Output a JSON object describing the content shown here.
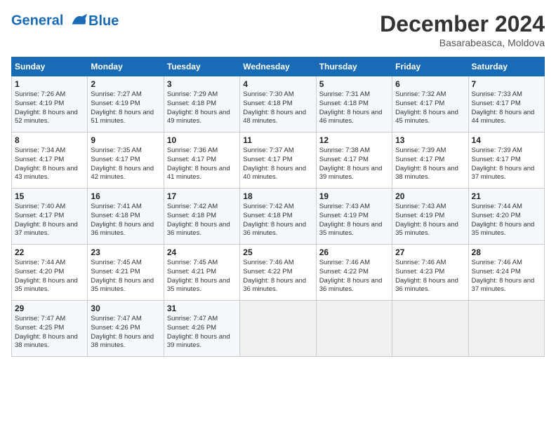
{
  "header": {
    "logo_line1": "General",
    "logo_line2": "Blue",
    "month_title": "December 2024",
    "subtitle": "Basarabeasca, Moldova"
  },
  "weekdays": [
    "Sunday",
    "Monday",
    "Tuesday",
    "Wednesday",
    "Thursday",
    "Friday",
    "Saturday"
  ],
  "weeks": [
    [
      {
        "day": "1",
        "sunrise": "Sunrise: 7:26 AM",
        "sunset": "Sunset: 4:19 PM",
        "daylight": "Daylight: 8 hours and 52 minutes."
      },
      {
        "day": "2",
        "sunrise": "Sunrise: 7:27 AM",
        "sunset": "Sunset: 4:19 PM",
        "daylight": "Daylight: 8 hours and 51 minutes."
      },
      {
        "day": "3",
        "sunrise": "Sunrise: 7:29 AM",
        "sunset": "Sunset: 4:18 PM",
        "daylight": "Daylight: 8 hours and 49 minutes."
      },
      {
        "day": "4",
        "sunrise": "Sunrise: 7:30 AM",
        "sunset": "Sunset: 4:18 PM",
        "daylight": "Daylight: 8 hours and 48 minutes."
      },
      {
        "day": "5",
        "sunrise": "Sunrise: 7:31 AM",
        "sunset": "Sunset: 4:18 PM",
        "daylight": "Daylight: 8 hours and 46 minutes."
      },
      {
        "day": "6",
        "sunrise": "Sunrise: 7:32 AM",
        "sunset": "Sunset: 4:17 PM",
        "daylight": "Daylight: 8 hours and 45 minutes."
      },
      {
        "day": "7",
        "sunrise": "Sunrise: 7:33 AM",
        "sunset": "Sunset: 4:17 PM",
        "daylight": "Daylight: 8 hours and 44 minutes."
      }
    ],
    [
      {
        "day": "8",
        "sunrise": "Sunrise: 7:34 AM",
        "sunset": "Sunset: 4:17 PM",
        "daylight": "Daylight: 8 hours and 43 minutes."
      },
      {
        "day": "9",
        "sunrise": "Sunrise: 7:35 AM",
        "sunset": "Sunset: 4:17 PM",
        "daylight": "Daylight: 8 hours and 42 minutes."
      },
      {
        "day": "10",
        "sunrise": "Sunrise: 7:36 AM",
        "sunset": "Sunset: 4:17 PM",
        "daylight": "Daylight: 8 hours and 41 minutes."
      },
      {
        "day": "11",
        "sunrise": "Sunrise: 7:37 AM",
        "sunset": "Sunset: 4:17 PM",
        "daylight": "Daylight: 8 hours and 40 minutes."
      },
      {
        "day": "12",
        "sunrise": "Sunrise: 7:38 AM",
        "sunset": "Sunset: 4:17 PM",
        "daylight": "Daylight: 8 hours and 39 minutes."
      },
      {
        "day": "13",
        "sunrise": "Sunrise: 7:39 AM",
        "sunset": "Sunset: 4:17 PM",
        "daylight": "Daylight: 8 hours and 38 minutes."
      },
      {
        "day": "14",
        "sunrise": "Sunrise: 7:39 AM",
        "sunset": "Sunset: 4:17 PM",
        "daylight": "Daylight: 8 hours and 37 minutes."
      }
    ],
    [
      {
        "day": "15",
        "sunrise": "Sunrise: 7:40 AM",
        "sunset": "Sunset: 4:17 PM",
        "daylight": "Daylight: 8 hours and 37 minutes."
      },
      {
        "day": "16",
        "sunrise": "Sunrise: 7:41 AM",
        "sunset": "Sunset: 4:18 PM",
        "daylight": "Daylight: 8 hours and 36 minutes."
      },
      {
        "day": "17",
        "sunrise": "Sunrise: 7:42 AM",
        "sunset": "Sunset: 4:18 PM",
        "daylight": "Daylight: 8 hours and 36 minutes."
      },
      {
        "day": "18",
        "sunrise": "Sunrise: 7:42 AM",
        "sunset": "Sunset: 4:18 PM",
        "daylight": "Daylight: 8 hours and 36 minutes."
      },
      {
        "day": "19",
        "sunrise": "Sunrise: 7:43 AM",
        "sunset": "Sunset: 4:19 PM",
        "daylight": "Daylight: 8 hours and 35 minutes."
      },
      {
        "day": "20",
        "sunrise": "Sunrise: 7:43 AM",
        "sunset": "Sunset: 4:19 PM",
        "daylight": "Daylight: 8 hours and 35 minutes."
      },
      {
        "day": "21",
        "sunrise": "Sunrise: 7:44 AM",
        "sunset": "Sunset: 4:20 PM",
        "daylight": "Daylight: 8 hours and 35 minutes."
      }
    ],
    [
      {
        "day": "22",
        "sunrise": "Sunrise: 7:44 AM",
        "sunset": "Sunset: 4:20 PM",
        "daylight": "Daylight: 8 hours and 35 minutes."
      },
      {
        "day": "23",
        "sunrise": "Sunrise: 7:45 AM",
        "sunset": "Sunset: 4:21 PM",
        "daylight": "Daylight: 8 hours and 35 minutes."
      },
      {
        "day": "24",
        "sunrise": "Sunrise: 7:45 AM",
        "sunset": "Sunset: 4:21 PM",
        "daylight": "Daylight: 8 hours and 35 minutes."
      },
      {
        "day": "25",
        "sunrise": "Sunrise: 7:46 AM",
        "sunset": "Sunset: 4:22 PM",
        "daylight": "Daylight: 8 hours and 36 minutes."
      },
      {
        "day": "26",
        "sunrise": "Sunrise: 7:46 AM",
        "sunset": "Sunset: 4:22 PM",
        "daylight": "Daylight: 8 hours and 36 minutes."
      },
      {
        "day": "27",
        "sunrise": "Sunrise: 7:46 AM",
        "sunset": "Sunset: 4:23 PM",
        "daylight": "Daylight: 8 hours and 36 minutes."
      },
      {
        "day": "28",
        "sunrise": "Sunrise: 7:46 AM",
        "sunset": "Sunset: 4:24 PM",
        "daylight": "Daylight: 8 hours and 37 minutes."
      }
    ],
    [
      {
        "day": "29",
        "sunrise": "Sunrise: 7:47 AM",
        "sunset": "Sunset: 4:25 PM",
        "daylight": "Daylight: 8 hours and 38 minutes."
      },
      {
        "day": "30",
        "sunrise": "Sunrise: 7:47 AM",
        "sunset": "Sunset: 4:26 PM",
        "daylight": "Daylight: 8 hours and 38 minutes."
      },
      {
        "day": "31",
        "sunrise": "Sunrise: 7:47 AM",
        "sunset": "Sunset: 4:26 PM",
        "daylight": "Daylight: 8 hours and 39 minutes."
      },
      null,
      null,
      null,
      null
    ]
  ]
}
